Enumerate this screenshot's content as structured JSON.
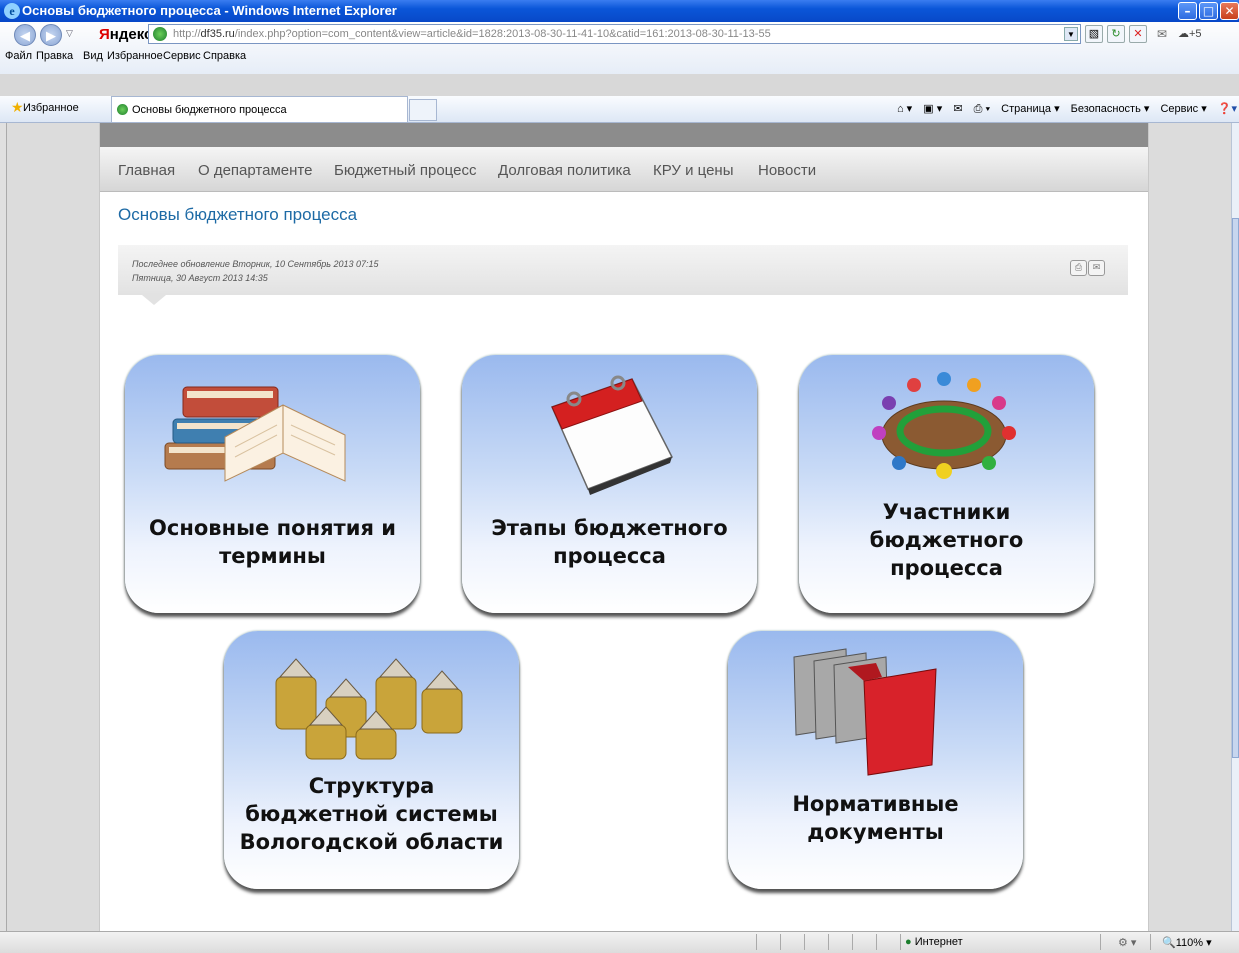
{
  "window": {
    "title": "Основы бюджетного процесса - Windows Internet Explorer",
    "minimize": "–",
    "maximize": "□",
    "close": "✕"
  },
  "address_bar": {
    "brand_red": "Я",
    "brand_rest": "ндекс",
    "url_prefix": "http://",
    "url_host": "df35.ru",
    "url_rest": "/index.php?option=com_content&view=article&id=1828:2013-08-30-11-41-10&catid=161:2013-08-30-11-13-55",
    "extra": "+5"
  },
  "menu": [
    "Файл",
    "Правка",
    "Вид",
    "Избранное",
    "Сервис",
    "Справка"
  ],
  "favorites_bar": {
    "favorites_label": "Избранное",
    "tab_title": "Основы бюджетного процесса",
    "commands": [
      "Страница ▾",
      "Безопасность ▾",
      "Сервис ▾"
    ]
  },
  "site_nav": [
    "Главная",
    "О департаменте",
    "Бюджетный процесс",
    "Долговая политика",
    "КРУ и цены",
    "Новости"
  ],
  "article": {
    "title": "Основы бюджетного процесса",
    "updated": "Последнее обновление Вторник, 10 Сентябрь 2013 07:15",
    "created": "Пятница, 30 Август 2013 14:35"
  },
  "tiles": {
    "t1": {
      "line1": "Основные понятия и",
      "line2": "термины"
    },
    "t2": {
      "line1": "Этапы бюджетного",
      "line2": "процесса"
    },
    "t3": {
      "line1": "Участники",
      "line2": "бюджетного",
      "line3": "процесса"
    },
    "t4": {
      "line1": "Структура",
      "line2": "бюджетной системы",
      "line3": "Вологодской области"
    },
    "t5": {
      "line1": "Нормативные",
      "line2": "документы"
    }
  },
  "status_bar": {
    "zone": "Интернет",
    "zoom": "110%"
  },
  "icons": [
    "ie-logo-icon",
    "back-icon",
    "forward-icon",
    "globe-icon",
    "star-icon",
    "home-icon",
    "rss-icon",
    "mail-icon",
    "print-icon",
    "help-icon",
    "email-icon"
  ]
}
